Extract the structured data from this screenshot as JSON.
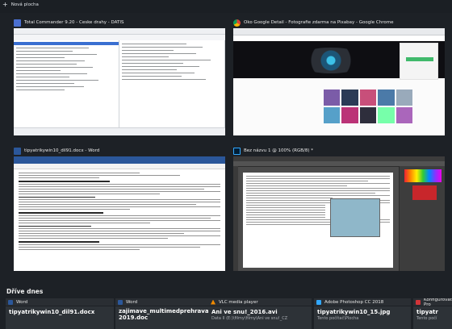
{
  "topbar": {
    "new_desktop_label": "Nová plocha"
  },
  "windows": [
    {
      "title": "Total Commander 9.20 - Ceske drahy - DATIS",
      "icon": "total-commander-icon",
      "icon_color": "#4a6fd0"
    },
    {
      "title": "Oko Google Detail - Fotografie zdarma na Pixabay - Google Chrome",
      "icon": "chrome-icon",
      "icon_color": "#e0b73a"
    },
    {
      "title": "tipyatrikywin10_dil91.docx - Word",
      "icon": "word-icon",
      "icon_color": "#2b579a"
    },
    {
      "title": "Bez názvu 1 @ 100% (RGB/8) *",
      "icon": "photoshop-icon",
      "icon_color": "#1f4f8a"
    }
  ],
  "timeline": {
    "heading": "Dříve dnes",
    "items": [
      {
        "app": "Word",
        "doc": "tipyatrikywin10_dil91.docx",
        "sub": "",
        "icon_color": "#2b579a"
      },
      {
        "app": "Word",
        "doc": "zajimave_multimedprehravace 2019.doc",
        "sub": "",
        "icon_color": "#2b579a"
      },
      {
        "app": "VLC media player",
        "doc": "Ani ve snu!_2016.avi",
        "sub": "Data II (E:)\\filmy\\filmy\\Ani ve snu!_CZ",
        "icon_color": "#f08a00"
      },
      {
        "app": "Adobe Photoshop CC 2018",
        "doc": "tipyatrikywin10_15.jpg",
        "sub": "Tento počítač\\Plocha",
        "icon_color": "#31a8ff"
      },
      {
        "app": "Konfigurovat Pro",
        "doc": "tipyatr",
        "sub": "Tento počí",
        "icon_color": "#d13438"
      }
    ]
  }
}
